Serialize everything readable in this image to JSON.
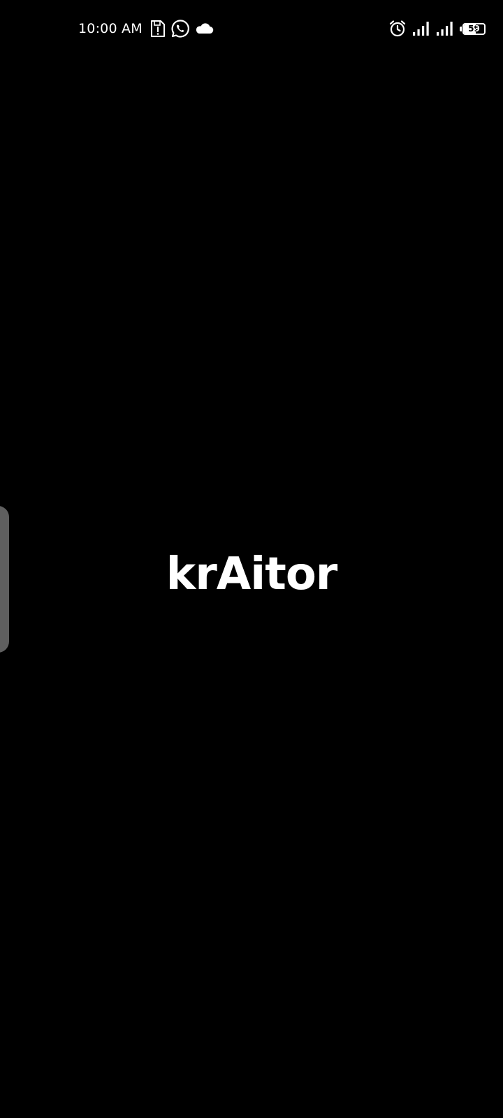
{
  "status_bar": {
    "time": "10:00 AM",
    "battery_level": "59",
    "battery_fraction": 0.59,
    "icons_left": [
      "sd-card-alert-icon",
      "whatsapp-icon",
      "cloud-icon"
    ],
    "icons_right": [
      "alarm-icon",
      "signal-sim1-icon",
      "signal-sim2-icon",
      "battery-icon"
    ]
  },
  "splash": {
    "app_name": "krAitor"
  },
  "colors": {
    "background": "#000000",
    "foreground": "#ffffff",
    "edge_handle": "#5f5f5f"
  }
}
